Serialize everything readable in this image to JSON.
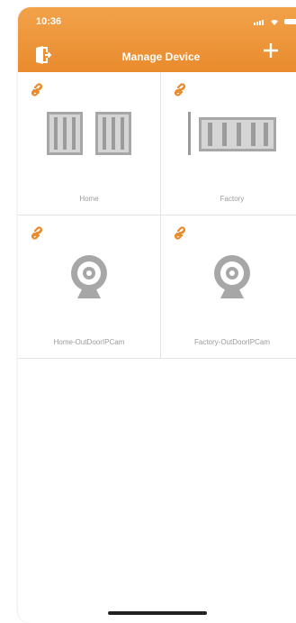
{
  "status": {
    "time": "10:36"
  },
  "header": {
    "title": "Manage Device"
  },
  "devices": [
    {
      "name": "Home",
      "type": "double-gate",
      "linked": true
    },
    {
      "name": "Factory",
      "type": "sliding-gate",
      "linked": true
    },
    {
      "name": "Home-OutDoorIPCam",
      "type": "ip-camera",
      "linked": true
    },
    {
      "name": "Factory-OutDoorIPCam",
      "type": "ip-camera",
      "linked": true
    }
  ],
  "colors": {
    "accent": "#e98b2d",
    "icon_gray": "#9b9b9b"
  },
  "icons": {
    "logout": "exit-door-icon",
    "add": "plus-icon",
    "link": "chain-link-icon"
  }
}
